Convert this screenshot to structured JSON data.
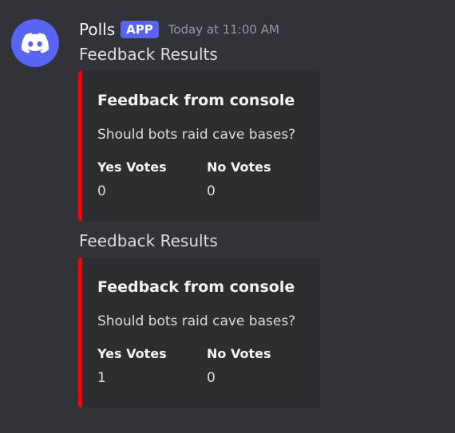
{
  "message": {
    "author": "Polls",
    "badge": "APP",
    "timestamp": "Today at 11:00 AM",
    "avatar_icon": "discord-logo-icon",
    "avatar_color": "#5865f2"
  },
  "embeds": [
    {
      "content": "Feedback Results",
      "title": "Feedback from console",
      "description": "Should bots raid cave bases?",
      "accent_color": "#ff0000",
      "fields": [
        {
          "name": "Yes Votes",
          "value": "0"
        },
        {
          "name": "No Votes",
          "value": "0"
        }
      ]
    },
    {
      "content": "Feedback Results",
      "title": "Feedback from console",
      "description": "Should bots raid cave bases?",
      "accent_color": "#ff0000",
      "fields": [
        {
          "name": "Yes Votes",
          "value": "1"
        },
        {
          "name": "No Votes",
          "value": "0"
        }
      ]
    }
  ]
}
